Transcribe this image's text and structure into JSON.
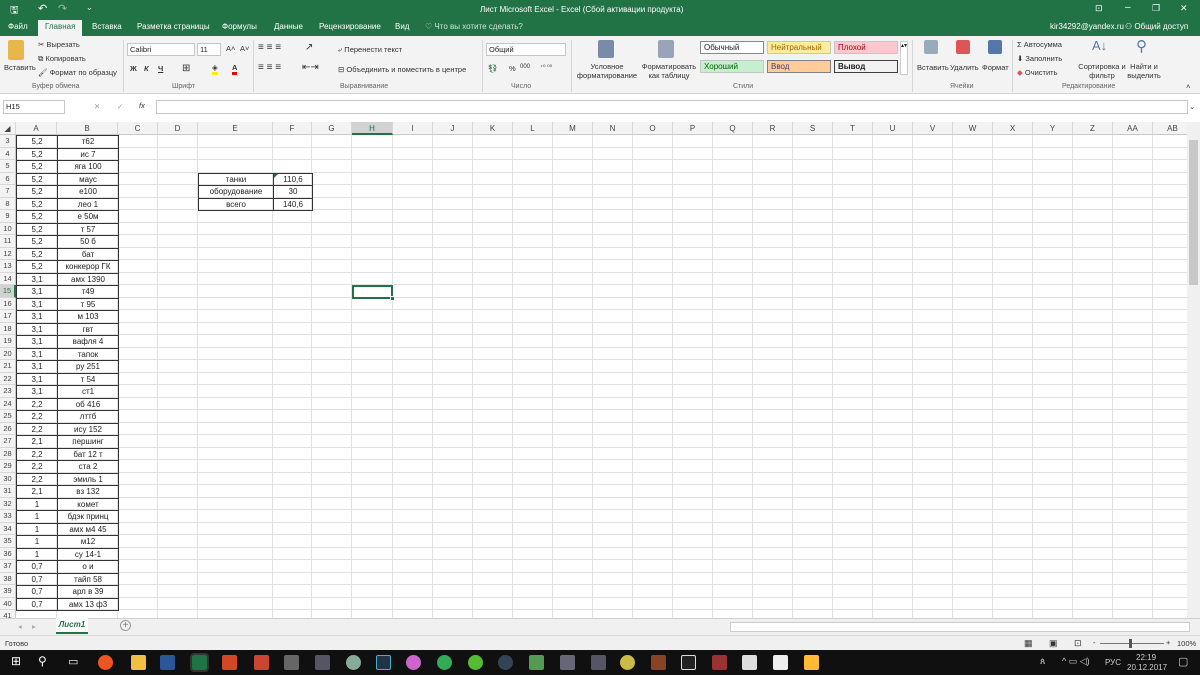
{
  "title": "Лист Microsoft Excel - Excel (Сбой активации продукта)",
  "quick_access": {
    "save": "save-icon",
    "undo": "undo-icon",
    "redo": "redo-icon"
  },
  "window_controls": {
    "ribbon_display": "⊡",
    "minimize": "–",
    "maximize": "❐",
    "close": "✕"
  },
  "user": "kir34292@yandex.ru",
  "share": "Общий доступ",
  "tabs": [
    "Файл",
    "Главная",
    "Вставка",
    "Разметка страницы",
    "Формулы",
    "Данные",
    "Рецензирование",
    "Вид"
  ],
  "tell_me": "Что вы хотите сделать?",
  "ribbon": {
    "clipboard": {
      "paste": "Вставить",
      "cut": "Вырезать",
      "copy": "Копировать",
      "format_painter": "Формат по образцу",
      "group": "Буфер обмена"
    },
    "font": {
      "name": "Calibri",
      "size": "11",
      "bold": "Ж",
      "italic": "К",
      "underline": "Ч",
      "grow": "A˄",
      "shrink": "A˅",
      "group": "Шрифт"
    },
    "alignment": {
      "wrap": "Перенести текст",
      "merge": "Объединить и поместить в центре",
      "group": "Выравнивание"
    },
    "number": {
      "format": "Общий",
      "percent": "%",
      "thousands": "000",
      "group": "Число"
    },
    "styles": {
      "conditional": "Условное форматирование",
      "as_table": "Форматировать как таблицу",
      "normal": "Обычный",
      "neutral": "Нейтральный",
      "bad": "Плохой",
      "good": "Хороший",
      "input": "Ввод",
      "output": "Вывод",
      "group": "Стили"
    },
    "cells": {
      "insert": "Вставить",
      "delete": "Удалить",
      "format": "Формат",
      "group": "Ячейки"
    },
    "editing": {
      "autosum": "Автосумма",
      "fill": "Заполнить",
      "clear": "Очистить",
      "sort": "Сортировка и фильтр",
      "find": "Найти и выделить",
      "group": "Редактирование"
    }
  },
  "name_box": "H15",
  "formula": "",
  "fx": "fx",
  "columns": [
    "A",
    "B",
    "C",
    "D",
    "E",
    "F",
    "G",
    "H",
    "I",
    "J",
    "K",
    "L",
    "M",
    "N",
    "O",
    "P",
    "Q",
    "R",
    "S",
    "T",
    "U",
    "V",
    "W",
    "X",
    "Y",
    "Z",
    "AA",
    "AB"
  ],
  "rows": [
    [
      "3",
      "5,2",
      "т62"
    ],
    [
      "4",
      "5,2",
      "ис 7"
    ],
    [
      "5",
      "5,2",
      "яга 100"
    ],
    [
      "6",
      "5,2",
      "маус"
    ],
    [
      "7",
      "5,2",
      "е100"
    ],
    [
      "8",
      "5,2",
      "лео 1"
    ],
    [
      "9",
      "5,2",
      "е 50м"
    ],
    [
      "10",
      "5,2",
      "т 57"
    ],
    [
      "11",
      "5,2",
      "50 б"
    ],
    [
      "12",
      "5,2",
      "бат"
    ],
    [
      "13",
      "5,2",
      "конкерор ГК"
    ],
    [
      "14",
      "3,1",
      "амх 1390"
    ],
    [
      "15",
      "3,1",
      "т49"
    ],
    [
      "16",
      "3,1",
      "т 95"
    ],
    [
      "17",
      "3,1",
      "м 103"
    ],
    [
      "18",
      "3,1",
      "гвт"
    ],
    [
      "19",
      "3,1",
      "вафля 4"
    ],
    [
      "20",
      "3,1",
      "тапок"
    ],
    [
      "21",
      "3,1",
      "ру 251"
    ],
    [
      "22",
      "3,1",
      "т 54"
    ],
    [
      "23",
      "3,1",
      "ст1"
    ],
    [
      "24",
      "2,2",
      "об 416"
    ],
    [
      "25",
      "2,2",
      "лттб"
    ],
    [
      "26",
      "2,2",
      "ису 152"
    ],
    [
      "27",
      "2,1",
      "першинг"
    ],
    [
      "28",
      "2,2",
      "бат 12 т"
    ],
    [
      "29",
      "2,2",
      "ста 2"
    ],
    [
      "30",
      "2,2",
      "эмиль 1"
    ],
    [
      "31",
      "2,1",
      "вз 132"
    ],
    [
      "32",
      "1",
      "комет"
    ],
    [
      "33",
      "1",
      "бдэк принц"
    ],
    [
      "34",
      "1",
      "амх м4 45"
    ],
    [
      "35",
      "1",
      "м12"
    ],
    [
      "36",
      "1",
      "су 14-1"
    ],
    [
      "37",
      "0,7",
      "о и"
    ],
    [
      "38",
      "0,7",
      "тайп 58"
    ],
    [
      "39",
      "0,7",
      "арл в 39"
    ],
    [
      "40",
      "0,7",
      "амх 13 ф3"
    ],
    [
      "41",
      "",
      ""
    ]
  ],
  "summary": [
    [
      "танки",
      "110,6"
    ],
    [
      "оборудование",
      "30"
    ],
    [
      "всего",
      "140,6"
    ]
  ],
  "selected_cell": "H15",
  "sheet_tab": "Лист1",
  "add_sheet": "+",
  "status": "Готово",
  "zoom": "100%",
  "taskbar": {
    "lang": "РУС",
    "time": "22:19",
    "date": "20.12.2017"
  },
  "colors": {
    "excel_green": "#217346",
    "ribbon": "#f3f3f3",
    "neutral": "#ffeb9c",
    "bad": "#ffc7ce",
    "good": "#c6efce",
    "input": "#ffcc99"
  }
}
